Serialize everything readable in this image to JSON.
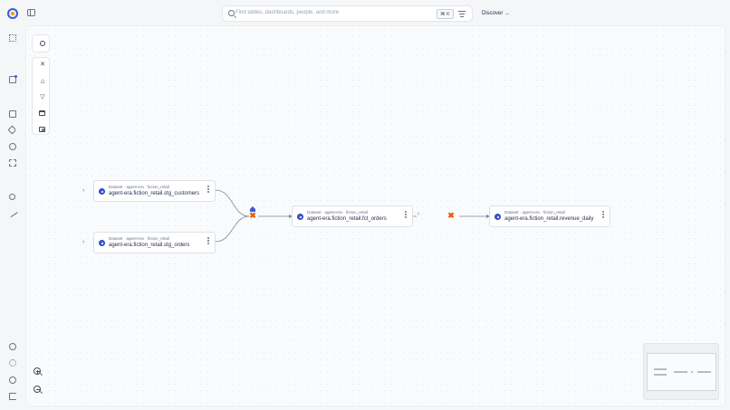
{
  "header": {
    "search_placeholder": "Find tables, dashboards, people, and more",
    "shortcut": "⌘ K",
    "discover_label": "Discover →"
  },
  "colors": {
    "accent": "#3b5bdb",
    "error_node": "#e8590c",
    "canvas_bg": "#fafbfc"
  },
  "lineage": {
    "nodes": [
      {
        "type": "Dataset",
        "owner": "agent-era",
        "schema": "fiction_retail",
        "name": "agent-era.fiction_retail.stg_customers"
      },
      {
        "type": "Dataset",
        "owner": "agent-era",
        "schema": "fiction_retail",
        "name": "agent-era.fiction_retail.stg_orders"
      },
      {
        "type": "Dataset",
        "owner": "agent-era",
        "schema": "fiction_retail",
        "name": "agent-era.fiction_retail.fct_orders"
      },
      {
        "type": "Dataset",
        "owner": "agent-era",
        "schema": "fiction_retail",
        "name": "agent-era.fiction_retail.revenue_daily"
      }
    ],
    "separator": "·"
  }
}
